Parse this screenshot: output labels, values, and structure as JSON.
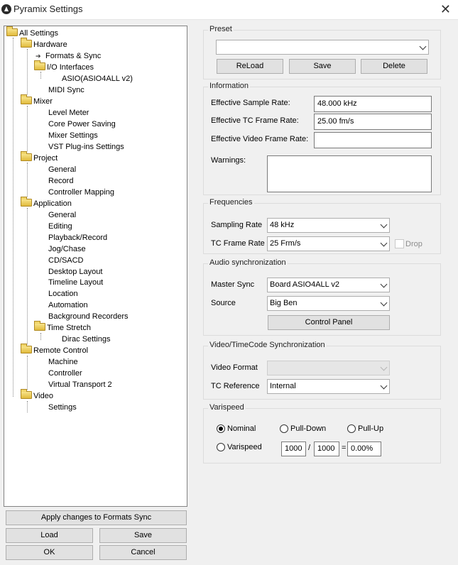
{
  "window": {
    "title": "Pyramix Settings"
  },
  "tree": {
    "root": "All Settings",
    "hardware": "Hardware",
    "formats_sync": "Formats & Sync",
    "io_interfaces": "I/O Interfaces",
    "asio": "ASIO(ASIO4ALL v2)",
    "midi_sync": "MIDI Sync",
    "mixer": "Mixer",
    "level_meter": "Level Meter",
    "core_power": "Core Power Saving",
    "mixer_settings": "Mixer Settings",
    "vst": "VST Plug-ins Settings",
    "project": "Project",
    "general1": "General",
    "record": "Record",
    "controller_mapping": "Controller Mapping",
    "application": "Application",
    "general2": "General",
    "editing": "Editing",
    "playback_record": "Playback/Record",
    "jog_chase": "Jog/Chase",
    "cd_sacd": "CD/SACD",
    "desktop_layout": "Desktop Layout",
    "timeline_layout": "Timeline Layout",
    "location": "Location",
    "automation": "Automation",
    "background_recorders": "Background Recorders",
    "time_stretch": "Time Stretch",
    "dirac": "Dirac Settings",
    "remote_control": "Remote Control",
    "machine": "Machine",
    "controller": "Controller",
    "virtual_transport": "Virtual Transport 2",
    "video": "Video",
    "settings": "Settings"
  },
  "buttons": {
    "apply": "Apply changes to Formats  Sync",
    "load": "Load",
    "save": "Save",
    "ok": "OK",
    "cancel": "Cancel"
  },
  "preset": {
    "title": "Preset",
    "selected": "",
    "reload": "ReLoad",
    "save": "Save",
    "delete": "Delete"
  },
  "information": {
    "title": "Information",
    "sample_rate_label": "Effective Sample Rate:",
    "sample_rate_value": "48.000 kHz",
    "tc_rate_label": "Effective TC Frame Rate:",
    "tc_rate_value": "25.00 fm/s",
    "video_rate_label": "Effective Video Frame Rate:",
    "video_rate_value": "",
    "warnings_label": "Warnings:",
    "warnings_value": ""
  },
  "frequencies": {
    "title": "Frequencies",
    "sampling_label": "Sampling Rate",
    "sampling_value": "48 kHz",
    "tc_label": "TC Frame Rate",
    "tc_value": "25 Frm/s",
    "drop_label": "Drop"
  },
  "audio_sync": {
    "title": "Audio synchronization",
    "master_label": "Master Sync",
    "master_value": "Board ASIO4ALL v2",
    "source_label": "Source",
    "source_value": "Big Ben",
    "control_panel": "Control Panel"
  },
  "video_sync": {
    "title": "Video/TimeCode Synchronization",
    "format_label": "Video Format",
    "format_value": "",
    "tc_ref_label": "TC Reference",
    "tc_ref_value": "Internal"
  },
  "varispeed": {
    "title": "Varispeed",
    "nominal": "Nominal",
    "pull_down": "Pull-Down",
    "pull_up": "Pull-Up",
    "varispeed": "Varispeed",
    "numerator": "1000",
    "slash": "/",
    "denominator": "1000",
    "equals": "=",
    "percent": "0.00%"
  }
}
